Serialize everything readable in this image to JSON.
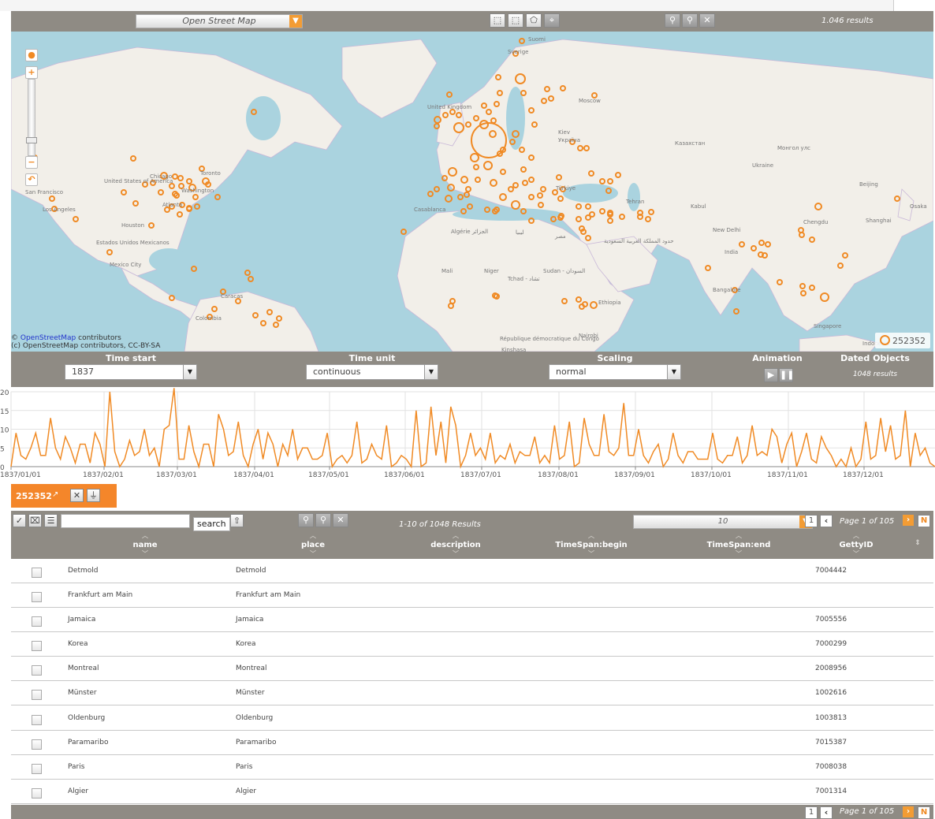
{
  "toolbar": {
    "map_layer": "Open Street Map",
    "results": "1.046 results"
  },
  "map": {
    "attribution_line1_prefix": "©",
    "attribution_line1_link": "OpenStreetMap",
    "attribution_line1_suffix": "contributors",
    "attribution_line2": "(c) OpenStreetMap contributors, CC-BY-SA",
    "legend_value": "252352",
    "zoom_in": "+",
    "zoom_out": "−",
    "labels": [
      "Suomi",
      "Sverige",
      "Moscow",
      "United Kingdom",
      "Kiev",
      "Україна",
      "Казахстан",
      "Монгол улс",
      "Türkiye",
      "Tehran",
      "Kabul",
      "New Delhi",
      "India",
      "Chengdu",
      "Beijing",
      "Shanghai",
      "Osaka",
      "Bangalore",
      "Singapore",
      "Indonesia",
      "Casablanca",
      "Algérie الجزائر",
      "ليبيا",
      "مصر",
      "Mali",
      "Niger",
      "Tchad - تشاد",
      "Sudan - السودان",
      "Ethiopia",
      "République démocratique du Congo",
      "Kinshasa",
      "Nairobi",
      "United States of America",
      "Toronto",
      "Chicago",
      "Washington",
      "Atlanta",
      "Houston",
      "San Francisco",
      "Los Angeles",
      "Estados Unidos Mexicanos",
      "Mexico City",
      "Caracas",
      "Colombia",
      "حدود المملكة العربية السعودية",
      "Ukraine"
    ]
  },
  "controls": {
    "time_start_label": "Time start",
    "time_start_value": "1837",
    "time_unit_label": "Time unit",
    "time_unit_value": "continuous",
    "scaling_label": "Scaling",
    "scaling_value": "normal",
    "animation_label": "Animation",
    "dated_label": "Dated Objects",
    "dated_value": "1048 results"
  },
  "chart_data": {
    "type": "line",
    "title": "",
    "xlabel": "",
    "ylabel": "",
    "ylim": [
      0,
      20
    ],
    "yticks": [
      "0",
      "5",
      "10",
      "15",
      "20"
    ],
    "xticks": [
      "1837/01/01",
      "1837/02/01",
      "1837/03/01",
      "1837/04/01",
      "1837/05/01",
      "1837/06/01",
      "1837/07/01",
      "1837/08/01",
      "1837/09/01",
      "1837/10/01",
      "1837/11/01",
      "1837/12/01"
    ],
    "color": "#f08a24",
    "series": [
      {
        "values": [
          0,
          9,
          3,
          2,
          5,
          9,
          3,
          3,
          13,
          5,
          2,
          8,
          5,
          1,
          6,
          6,
          1,
          9,
          6,
          0,
          20,
          4,
          0,
          2,
          7,
          3,
          4,
          10,
          3,
          5,
          0,
          10,
          11,
          21,
          2,
          2,
          11,
          4,
          0,
          6,
          6,
          0,
          14,
          10,
          3,
          4,
          12,
          3,
          0,
          6,
          10,
          2,
          9,
          6,
          0,
          6,
          3,
          10,
          2,
          5,
          5,
          2,
          2,
          3,
          9,
          0,
          2,
          3,
          1,
          3,
          12,
          1,
          2,
          6,
          3,
          2,
          11,
          0,
          1,
          3,
          2,
          0,
          15,
          0,
          1,
          16,
          3,
          12,
          1,
          16,
          11,
          0,
          3,
          9,
          3,
          5,
          2,
          9,
          1,
          3,
          2,
          6,
          1,
          4,
          3,
          3,
          8,
          1,
          3,
          1,
          11,
          2,
          3,
          12,
          0,
          1,
          13,
          6,
          3,
          3,
          14,
          4,
          3,
          5,
          17,
          3,
          3,
          10,
          3,
          1,
          4,
          6,
          0,
          2,
          9,
          3,
          1,
          4,
          4,
          2,
          2,
          2,
          9,
          2,
          1,
          3,
          3,
          8,
          1,
          3,
          11,
          3,
          4,
          3,
          10,
          8,
          1,
          6,
          9,
          0,
          4,
          9,
          2,
          1,
          8,
          5,
          3,
          0,
          2,
          0,
          5,
          0,
          2,
          12,
          2,
          3,
          13,
          4,
          11,
          2,
          3,
          15,
          0,
          9,
          3,
          5,
          1,
          0
        ]
      }
    ]
  },
  "tag": {
    "label": "252352",
    "close": "✕"
  },
  "table_toolbar": {
    "search_button": "search",
    "search_value": "",
    "results_text": "1-10 of 1048 Results",
    "per_page": "10",
    "page_num": "1",
    "page_text": "Page 1 of 105",
    "last": "N"
  },
  "table": {
    "columns": [
      "name",
      "place",
      "description",
      "TimeSpan:begin",
      "TimeSpan:end",
      "GettyID"
    ],
    "rows": [
      {
        "name": "Detmold",
        "place": "Detmold",
        "getty": "7004442"
      },
      {
        "name": "Frankfurt am Main",
        "place": "Frankfurt am Main",
        "getty": ""
      },
      {
        "name": "Jamaica",
        "place": "Jamaica",
        "getty": "7005556"
      },
      {
        "name": "Korea",
        "place": "Korea",
        "getty": "7000299"
      },
      {
        "name": "Montreal",
        "place": "Montreal",
        "getty": "2008956"
      },
      {
        "name": "Münster",
        "place": "Münster",
        "getty": "1002616"
      },
      {
        "name": "Oldenburg",
        "place": "Oldenburg",
        "getty": "1003813"
      },
      {
        "name": "Paramaribo",
        "place": "Paramaribo",
        "getty": "7015387"
      },
      {
        "name": "Paris",
        "place": "Paris",
        "getty": "7008038"
      },
      {
        "name": "Algier",
        "place": "Algier",
        "getty": "7001314"
      }
    ]
  },
  "footer": {
    "page_num": "1",
    "page_text": "Page 1 of 105",
    "last": "N"
  }
}
